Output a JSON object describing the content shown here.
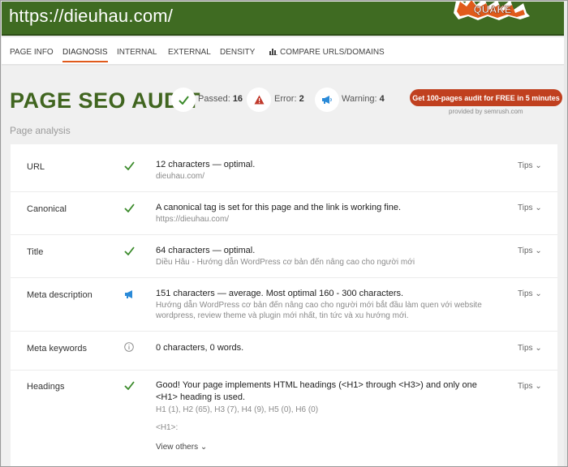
{
  "header": {
    "url": "https://dieuhau.com/",
    "logo_text": "QUAKE"
  },
  "tabs": [
    "PAGE INFO",
    "DIAGNOSIS",
    "INTERNAL",
    "EXTERNAL",
    "DENSITY",
    "COMPARE URLS/DOMAINS"
  ],
  "active_tab": "DIAGNOSIS",
  "audit": {
    "title": "PAGE SEO AUDIT",
    "passed_label": "Passed:",
    "passed_count": "16",
    "error_label": "Error:",
    "error_count": "2",
    "warning_label": "Warning:",
    "warning_count": "4",
    "cta": "Get 100-pages audit for FREE in 5 minutes",
    "provided_by": "provided by semrush.com",
    "subtitle": "Page analysis"
  },
  "rows": [
    {
      "label": "URL",
      "status": "passed",
      "main": "12 characters — optimal.",
      "desc": "dieuhau.com/",
      "tips": "Tips"
    },
    {
      "label": "Canonical",
      "status": "passed",
      "main": "A canonical tag is set for this page and the link is working fine.",
      "desc": "https://dieuhau.com/",
      "tips": "Tips"
    },
    {
      "label": "Title",
      "status": "passed",
      "main": "64 characters — optimal.",
      "desc": "Diều Hâu - Hướng dẫn WordPress cơ bản đến nâng cao cho người mới",
      "tips": "Tips"
    },
    {
      "label": "Meta description",
      "status": "warning",
      "main": "151 characters — average. Most optimal 160 - 300 characters.",
      "desc": "Hướng dẫn WordPress cơ bản đến nâng cao cho người mới bắt đầu làm quen với website wordpress, review theme và plugin mới nhất, tin tức và xu hướng mới.",
      "tips": "Tips"
    },
    {
      "label": "Meta keywords",
      "status": "info",
      "main": "0 characters, 0 words.",
      "desc": "",
      "tips": "Tips"
    },
    {
      "label": "Headings",
      "status": "passed",
      "main": "Good! Your page implements HTML headings (<H1> through <H3>) and only one <H1> heading is used.",
      "desc": "H1 (1), H2 (65), H3 (7), H4 (9), H5 (0), H6 (0)",
      "extra": "<H1>:",
      "view_others": "View others",
      "tips": "Tips"
    }
  ],
  "colors": {
    "header_green": "#3f6b22",
    "title_green": "#40651f",
    "check_green": "#3a8a2a",
    "error_red": "#c0392b",
    "warning_blue": "#2a8ad8",
    "cta_red": "#c0401f"
  }
}
